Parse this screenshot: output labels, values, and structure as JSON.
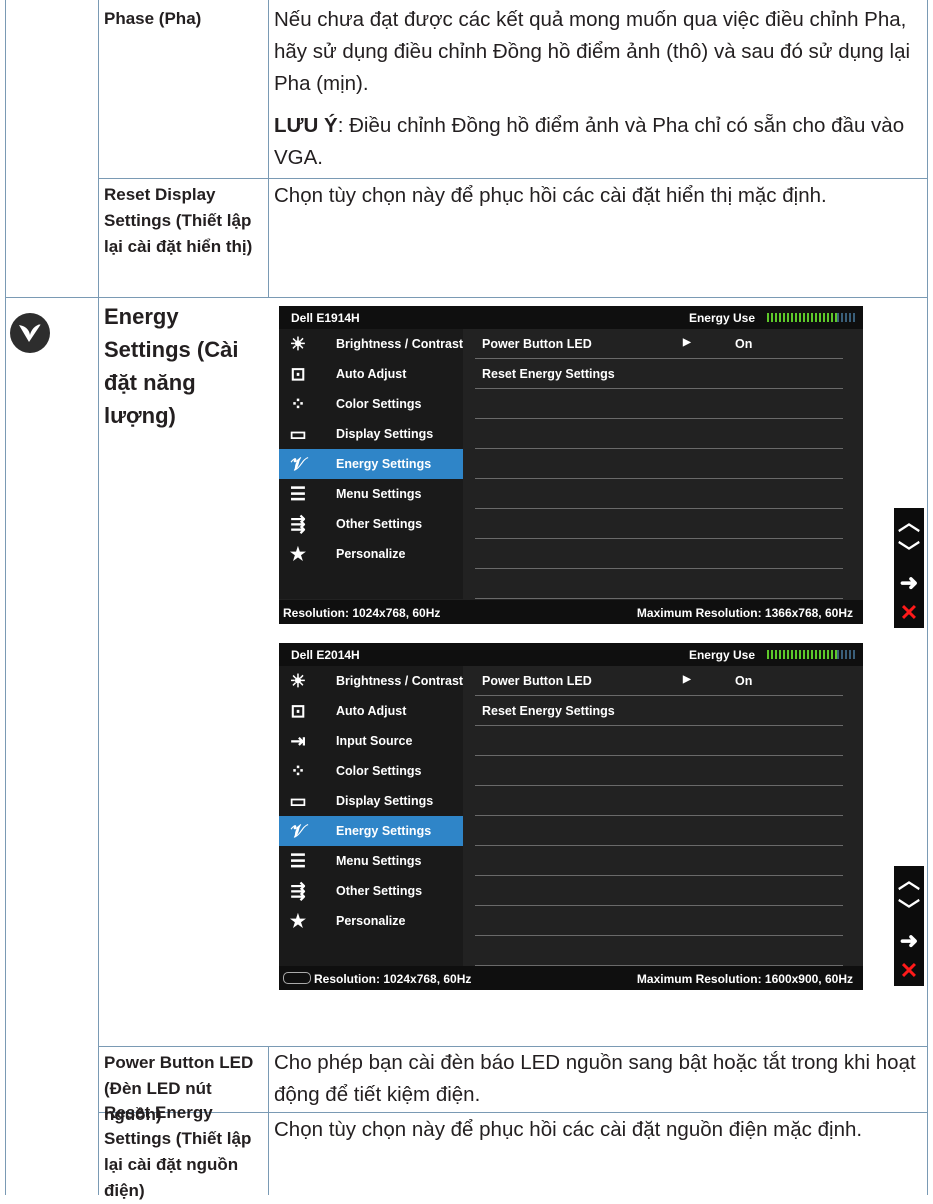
{
  "rows": {
    "phase": {
      "label": "Phase (Pha)",
      "desc": "Nếu chưa đạt được các kết quả mong muốn qua việc điều chỉnh Pha, hãy sử dụng điều chỉnh Đồng hồ điểm ảnh (thô) và sau đó sử dụng lại Pha (mịn).",
      "note_label": "LƯU Ý",
      "note_text": ": Điều chỉnh Đồng hồ điểm ảnh và Pha chỉ có sẵn cho đầu vào VGA."
    },
    "reset_display": {
      "label": "Reset Display Settings (Thiết lập lại cài đặt hiển thị)",
      "desc": "Chọn tùy chọn này để phục hồi các cài đặt hiển thị mặc định."
    },
    "energy": {
      "label": "Energy Settings (Cài đặt năng lượng)",
      "icon": "energy-leaf-icon"
    },
    "power_led": {
      "label": "Power Button LED (Đèn LED nút nguồn)",
      "desc": "Cho phép bạn cài đèn báo LED nguồn sang bật hoặc tắt trong khi hoạt động để tiết kiệm điện."
    },
    "reset_energy": {
      "label": "Reset Energy Settings (Thiết lập lại cài đặt nguồn điện)",
      "desc": "Chọn tùy chọn này để phục hồi các cài đặt nguồn điện mặc định."
    }
  },
  "osd1": {
    "model": "Dell E1914H",
    "energy_label": "Energy Use",
    "menu": [
      {
        "label": "Brightness / Contrast",
        "icon": "brightness-icon"
      },
      {
        "label": "Auto Adjust",
        "icon": "auto-adjust-icon"
      },
      {
        "label": "Color Settings",
        "icon": "color-settings-icon"
      },
      {
        "label": "Display Settings",
        "icon": "display-settings-icon"
      },
      {
        "label": "Energy Settings",
        "icon": "energy-icon",
        "selected": true
      },
      {
        "label": "Menu Settings",
        "icon": "menu-settings-icon"
      },
      {
        "label": "Other Settings",
        "icon": "other-settings-icon"
      },
      {
        "label": "Personalize",
        "icon": "star-icon"
      }
    ],
    "power_led": "Power Button LED",
    "power_led_value": "On",
    "reset_energy": "Reset Energy Settings",
    "resolution": "Resolution: 1024x768, 60Hz",
    "max_resolution": "Maximum Resolution: 1366x768, 60Hz"
  },
  "osd2": {
    "model": "Dell E2014H",
    "energy_label": "Energy Use",
    "menu": [
      {
        "label": "Brightness / Contrast",
        "icon": "brightness-icon"
      },
      {
        "label": "Auto Adjust",
        "icon": "auto-adjust-icon"
      },
      {
        "label": "Input Source",
        "icon": "input-source-icon"
      },
      {
        "label": "Color Settings",
        "icon": "color-settings-icon"
      },
      {
        "label": "Display Settings",
        "icon": "display-settings-icon"
      },
      {
        "label": "Energy Settings",
        "icon": "energy-icon",
        "selected": true
      },
      {
        "label": "Menu Settings",
        "icon": "menu-settings-icon"
      },
      {
        "label": "Other Settings",
        "icon": "other-settings-icon"
      },
      {
        "label": "Personalize",
        "icon": "star-icon"
      }
    ],
    "power_led": "Power Button LED",
    "power_led_value": "On",
    "reset_energy": "Reset Energy Settings",
    "resolution": "Resolution: 1024x768, 60Hz",
    "max_resolution": "Maximum Resolution: 1600x900, 60Hz"
  },
  "keys": [
    "up-arrow-icon",
    "down-arrow-icon",
    "enter-arrow-icon",
    "exit-x-icon"
  ]
}
